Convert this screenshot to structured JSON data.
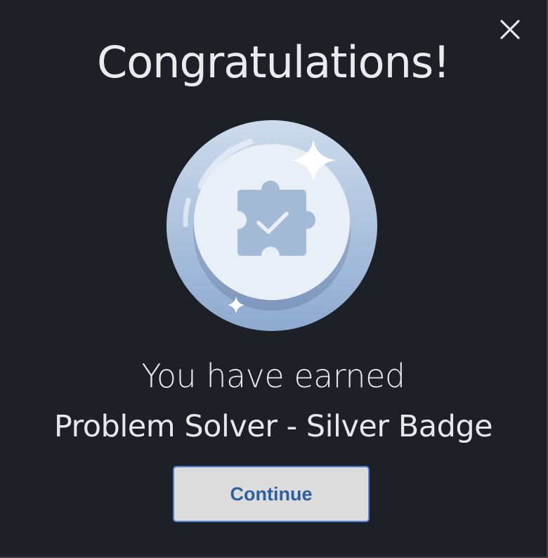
{
  "dialog": {
    "title": "Congratulations!",
    "earned_text": "You have earned",
    "badge_name": "Problem Solver - Silver Badge",
    "continue_label": "Continue",
    "close_icon": "close-icon",
    "badge_icon": "puzzle-check-icon"
  },
  "colors": {
    "background": "#1e2027",
    "text": "#e6e8ec",
    "button_bg": "#dcdcdc",
    "button_border": "#4f7fd9",
    "button_text": "#2d5f9e",
    "badge_outer": "#b7cbe3",
    "badge_inner": "#e9eff7",
    "badge_icon": "#a3bbd7"
  }
}
